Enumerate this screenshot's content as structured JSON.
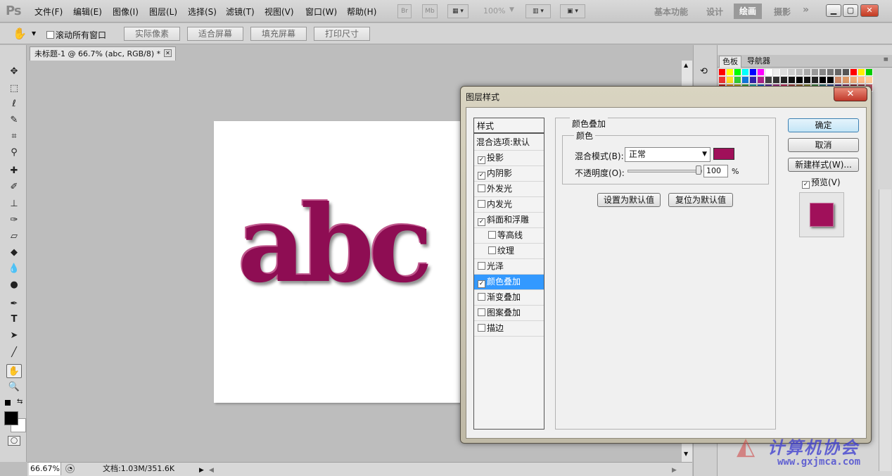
{
  "app": {
    "logo": "Ps"
  },
  "menu": [
    "文件(F)",
    "编辑(E)",
    "图像(I)",
    "图层(L)",
    "选择(S)",
    "滤镜(T)",
    "视图(V)",
    "窗口(W)",
    "帮助(H)"
  ],
  "menubar": {
    "bridge": "Br",
    "minibridge": "Mb",
    "zoom": "100%"
  },
  "workspaces": [
    "基本功能",
    "设计",
    "绘画",
    "摄影"
  ],
  "workspace_active": "绘画",
  "workspace_more": "»",
  "options": {
    "scroll_all": "滚动所有窗口",
    "buttons": [
      "实际像素",
      "适合屏幕",
      "填充屏幕",
      "打印尺寸"
    ]
  },
  "document": {
    "tab_title": "未标题-1 @ 66.7% (abc, RGB/8) *",
    "canvas_text": "abc",
    "text_color": "#8e0d53"
  },
  "status": {
    "zoom": "66.67%",
    "doc_info": "文档:1.03M/351.6K"
  },
  "panels": {
    "tabs": [
      "色板",
      "导航器"
    ]
  },
  "dialog": {
    "title": "图层样式",
    "close": "✕",
    "styles_header": "样式",
    "blend_options": "混合选项:默认",
    "styles": [
      {
        "label": "投影",
        "checked": true
      },
      {
        "label": "内阴影",
        "checked": true
      },
      {
        "label": "外发光",
        "checked": false
      },
      {
        "label": "内发光",
        "checked": false
      },
      {
        "label": "斜面和浮雕",
        "checked": true
      },
      {
        "label": "等高线",
        "checked": false,
        "sub": true
      },
      {
        "label": "纹理",
        "checked": false,
        "sub": true
      },
      {
        "label": "光泽",
        "checked": false
      },
      {
        "label": "颜色叠加",
        "checked": true,
        "selected": true
      },
      {
        "label": "渐变叠加",
        "checked": false
      },
      {
        "label": "图案叠加",
        "checked": false
      },
      {
        "label": "描边",
        "checked": false
      }
    ],
    "section_title": "颜色叠加",
    "group_title": "颜色",
    "blend_mode_label": "混合模式(B):",
    "blend_mode_value": "正常",
    "overlay_color": "#a0105a",
    "opacity_label": "不透明度(O):",
    "opacity_value": "100",
    "opacity_unit": "%",
    "opacity_level": 1.0,
    "set_default": "设置为默认值",
    "reset_default": "复位为默认值",
    "ok": "确定",
    "cancel": "取消",
    "new_style": "新建样式(W)...",
    "preview_label": "预览(V)",
    "preview_checked": true
  },
  "watermark": {
    "text": "计算机协会",
    "url": "www.gxjmca.com"
  }
}
